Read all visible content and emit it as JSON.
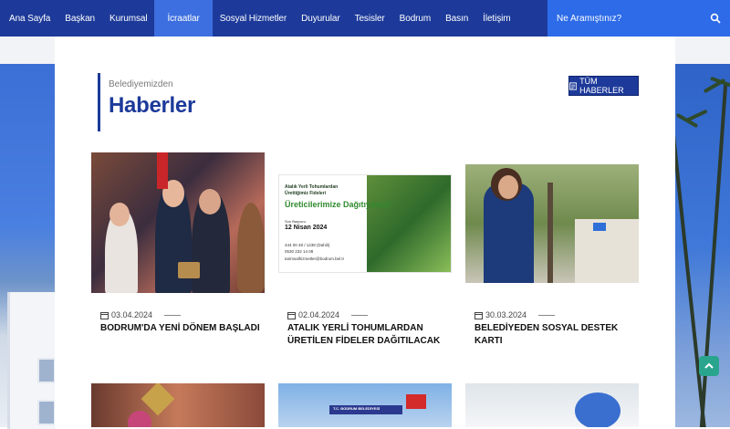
{
  "nav": {
    "items": [
      {
        "label": "Ana Sayfa",
        "active": false
      },
      {
        "label": "Başkan",
        "active": false
      },
      {
        "label": "Kurumsal",
        "active": false
      },
      {
        "label": "İcraatlar",
        "active": true
      },
      {
        "label": "Sosyal Hizmetler",
        "active": false
      },
      {
        "label": "Duyurular",
        "active": false
      },
      {
        "label": "Tesisler",
        "active": false
      },
      {
        "label": "Bodrum",
        "active": false
      },
      {
        "label": "Basın",
        "active": false
      },
      {
        "label": "İletişim",
        "active": false
      }
    ],
    "search_placeholder": "Ne Aramıştınız?"
  },
  "section": {
    "subtitle": "Belediyemizden",
    "title": "Haberler",
    "all_news_label": "TÜM HABERLER"
  },
  "news": [
    {
      "date": "03.04.2024",
      "title": "BODRUM'DA YENİ DÖNEM BAŞLADI"
    },
    {
      "date": "02.04.2024",
      "title": "ATALIK YERLİ TOHUMLARDAN ÜRETİLEN FİDELER DAĞITILACAK"
    },
    {
      "date": "30.03.2024",
      "title": "BELEDİYEDEN SOSYAL DESTEK KARTI"
    }
  ],
  "poster": {
    "line1": "Atalık Yerli Tohumlardan",
    "line2": "Ürettiğimiz Fideleri",
    "headline": "Üreticilerimize Dağıtıyoruz!",
    "deadline_label": "Son Başvuru",
    "deadline_date": "12 Nisan 2024",
    "contact1": "444 00 48 / 1238 (Dahili)",
    "contact2": "0530 232 14 08",
    "email": "tarimsalhizmetler@bodrum.bel.tr"
  },
  "bottom_banner": "T.C. BODRUM BELEDİYESİ",
  "colors": {
    "nav": "#1d3a9a",
    "active": "#3d6fe0",
    "search": "#2d6be8",
    "accent": "#1d3a9a"
  }
}
